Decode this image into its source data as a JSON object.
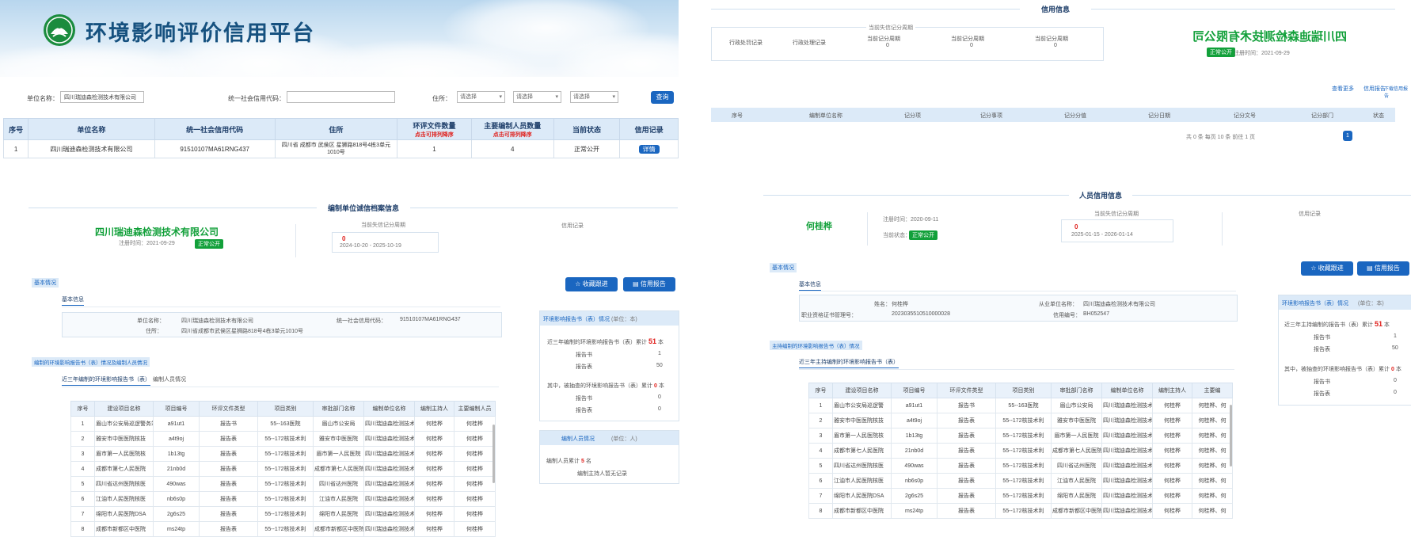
{
  "banner": {
    "title": "环境影响评价信用平台"
  },
  "search": {
    "unit_label": "单位名称：",
    "unit_value": "四川瑞迪森检测技术有限公司",
    "credit_label": "统一社会信用代码：",
    "credit_value": "",
    "addr_label": "住所：",
    "sel1": "请选择",
    "sel2": "请选择",
    "sel3": "请选择",
    "query_btn": "查询"
  },
  "result_table": {
    "headers": [
      "序号",
      "单位名称",
      "统一社会信用代码",
      "住所",
      "环评文件数量",
      "主要编制人员数量",
      "当前状态",
      "信用记录"
    ],
    "hint": "点击可排列降序",
    "row": {
      "no": "1",
      "name": "四川瑞迪森检测技术有限公司",
      "code": "91510107MA61RNG437",
      "addr": "四川省 成都市 武侯区 星狮路818号4栋3单元1010号",
      "files": "1",
      "persons": "4",
      "status": "正常公开",
      "action": "详情"
    }
  },
  "unit_section": {
    "title": "编制单位诚信档案信息",
    "company": "四川瑞迪森检测技术有限公司",
    "reg_date": "注册时间：2021-09-29",
    "status": "正常公开",
    "period_label": "当前失信记分周期",
    "score": "0",
    "period": "2024-10-20 - 2025-10-19",
    "credit_label": "信用记录",
    "btn1": "收藏跟进",
    "btn2": "信用报告",
    "basic_tag": "基本情况",
    "basic_tab": "基本信息",
    "f_name_label": "单位名称：",
    "f_name": "四川瑞迪森检测技术有限公司",
    "f_code_label": "统一社会信用代码：",
    "f_code": "91510107MA61RNG437",
    "f_addr_label": "住所：",
    "f_addr": "四川省成都市武侯区星狮路818号4栋3单元1010号",
    "docs_tag": "编制的环境影响报告书（表）情况及编制人员情况",
    "tab1": "近三年编制的环境影响报告书（表）",
    "tab2": "编制人员情况",
    "docs_headers": [
      "序号",
      "建设项目名称",
      "项目编号",
      "环评文件类型",
      "项目类别",
      "审批部门名称",
      "编制单位名称",
      "编制主持人",
      "主要编制人员"
    ],
    "docs": [
      [
        "1",
        "眉山市公安局巡逻警务站",
        "a91ut1",
        "报告书",
        "55--163医院",
        "眉山市公安局",
        "四川瑞迪森检测技术",
        "何桂桦",
        "何桂桦"
      ],
      [
        "2",
        "雅安市中医医院核技",
        "a4t9oj",
        "报告表",
        "55--172核技术利",
        "雅安市中医医院",
        "四川瑞迪森检测技术",
        "何桂桦",
        "何桂桦"
      ],
      [
        "3",
        "眉市第一人民医院核",
        "1b13tg",
        "报告表",
        "55--172核技术利",
        "眉市第一人民医院",
        "四川瑞迪森检测技术",
        "何桂桦",
        "何桂桦"
      ],
      [
        "4",
        "成都市第七人民医院",
        "21nb0d",
        "报告表",
        "55--172核技术利",
        "成都市第七人民医院",
        "四川瑞迪森检测技术",
        "何桂桦",
        "何桂桦"
      ],
      [
        "5",
        "四川省达州医院核医",
        "490was",
        "报告表",
        "55--172核技术利",
        "四川省达州医院",
        "四川瑞迪森检测技术",
        "何桂桦",
        "何桂桦"
      ],
      [
        "6",
        "江油市人民医院核医",
        "nb6s0p",
        "报告表",
        "55--172核技术利",
        "江油市人民医院",
        "四川瑞迪森检测技术",
        "何桂桦",
        "何桂桦"
      ],
      [
        "7",
        "绵阳市人民医院DSA",
        "2g6s25",
        "报告表",
        "55--172核技术利",
        "绵阳市人民医院",
        "四川瑞迪森检测技术",
        "何桂桦",
        "何桂桦"
      ],
      [
        "8",
        "成都市新都区中医院",
        "ms24tp",
        "报告表",
        "55--172核技术利",
        "成都市新都区中医院",
        "四川瑞迪森检测技术",
        "何桂桦",
        "何桂桦"
      ]
    ],
    "side_title": "环境影响报告书（表）情况",
    "side_sub": "(单位：本)",
    "side_recent": "近三年编制的环境影响报告书（表）累计",
    "side_recent_n": "51",
    "side_unit": "本",
    "side_r1": "报告书",
    "side_r1v": "1",
    "side_r2": "报告表",
    "side_r2v": "50",
    "side_other": "其中，被抽查的环境影响报告书（表）累计",
    "side_other_n": "0",
    "side_o1": "报告书",
    "side_o1v": "0",
    "side_o2": "报告表",
    "side_o2v": "0",
    "side2_title": "编制人员情况",
    "side2_sub": "(单位：人)",
    "side2_line": "编制人员累计",
    "side2_n": "5",
    "side2_unit": "名",
    "side2_note": "编制主持人暂无记录"
  },
  "person_section": {
    "title": "人员信用信息",
    "name": "何桂桦",
    "reg": "注册时间：2020-09-11",
    "status_label": "当前状态：",
    "status": "正常公开",
    "period_label": "当前失信记分周期",
    "score": "0",
    "period": "2025-01-15 - 2026-01-14",
    "credit_label": "信用记录",
    "btn1": "收藏跟进",
    "btn2": "信用报告",
    "basic_tag": "基本情况",
    "basic_tab": "基本信息",
    "f1_label": "姓名：",
    "f1": "何桂桦",
    "f2_label": "从业单位名称：",
    "f2": "四川瑞迪森检测技术有限公司",
    "f3_label": "职业资格证书管理号：",
    "f3": "2023035510510000028",
    "f4_label": "信用编号：",
    "f4": "BH052547",
    "docs_tag": "主持编制的环境影响报告书（表）情况",
    "tab1": "近三年主持编制的环境影响报告书（表）",
    "docs_headers": [
      "序号",
      "建设项目名称",
      "项目编号",
      "环评文件类型",
      "项目类别",
      "审批部门名称",
      "编制单位名称",
      "编制主持人",
      "主要编"
    ],
    "docs": [
      [
        "1",
        "眉山市公安局巡逻警",
        "a91ut1",
        "报告书",
        "55--163医院",
        "眉山市公安局",
        "四川瑞迪森检测技术",
        "何桂桦",
        "何桂桦、何"
      ],
      [
        "2",
        "雅安市中医医院核技",
        "a4t9oj",
        "报告表",
        "55--172核技术利",
        "雅安市中医医院",
        "四川瑞迪森检测技术",
        "何桂桦",
        "何桂桦、何"
      ],
      [
        "3",
        "眉市第一人民医院核",
        "1b13tg",
        "报告表",
        "55--172核技术利",
        "眉市第一人民医院",
        "四川瑞迪森检测技术",
        "何桂桦",
        "何桂桦、何"
      ],
      [
        "4",
        "成都市第七人民医院",
        "21nb0d",
        "报告表",
        "55--172核技术利",
        "成都市第七人民医院",
        "四川瑞迪森检测技术",
        "何桂桦",
        "何桂桦、何"
      ],
      [
        "5",
        "四川省达州医院核医",
        "490was",
        "报告表",
        "55--172核技术利",
        "四川省达州医院",
        "四川瑞迪森检测技术",
        "何桂桦",
        "何桂桦、何"
      ],
      [
        "6",
        "江油市人民医院核医",
        "nb6s0p",
        "报告表",
        "55--172核技术利",
        "江油市人民医院",
        "四川瑞迪森检测技术",
        "何桂桦",
        "何桂桦、何"
      ],
      [
        "7",
        "绵阳市人民医院DSA",
        "2g6s25",
        "报告表",
        "55--172核技术利",
        "绵阳市人民医院",
        "四川瑞迪森检测技术",
        "何桂桦",
        "何桂桦、何"
      ],
      [
        "8",
        "成都市新都区中医院",
        "ms24tp",
        "报告表",
        "55--172核技术利",
        "成都市新都区中医院",
        "四川瑞迪森检测技术",
        "何桂桦",
        "何桂桦、何"
      ]
    ],
    "side_title": "环境影响报告书（表）情况",
    "side_sub": "(单位：本)",
    "side_recent": "近三年主持编制的报告书（表）累计",
    "side_recent_n": "51",
    "side_unit": "本",
    "side_r1": "报告书",
    "side_r1v": "1",
    "side_r2": "报告表",
    "side_r2v": "50",
    "side_other": "其中，被抽查的环境影响报告书（表）累计",
    "side_other_n": "0",
    "side_o1": "报告书",
    "side_o1v": "0",
    "side_o2": "报告表",
    "side_o2v": "0"
  },
  "mirror_section": {
    "title": "信用信息",
    "company": "四川瑞迪森检测技术有限公司",
    "status": "正常公开",
    "reg": "注册时间：2021-09-29",
    "box_title": "当前失信记分周期",
    "c1": "当前记分周期",
    "c1v": "0",
    "c2": "当前记分周期",
    "c2v": "0",
    "c3": "当前记分周期",
    "c3v": "0",
    "r1": "行政处罚记录",
    "r2": "行政处理记录",
    "links": [
      "查看更多",
      "信用报告",
      "下载信用报告"
    ],
    "headers": [
      "序号",
      "编制单位名称",
      "记分项",
      "记分事项",
      "记分分值",
      "记分日期",
      "记分文号",
      "记分部门",
      "状态"
    ],
    "pager": "共 0 条  每页 10 条  前往 1 页",
    "page_num": "1"
  }
}
